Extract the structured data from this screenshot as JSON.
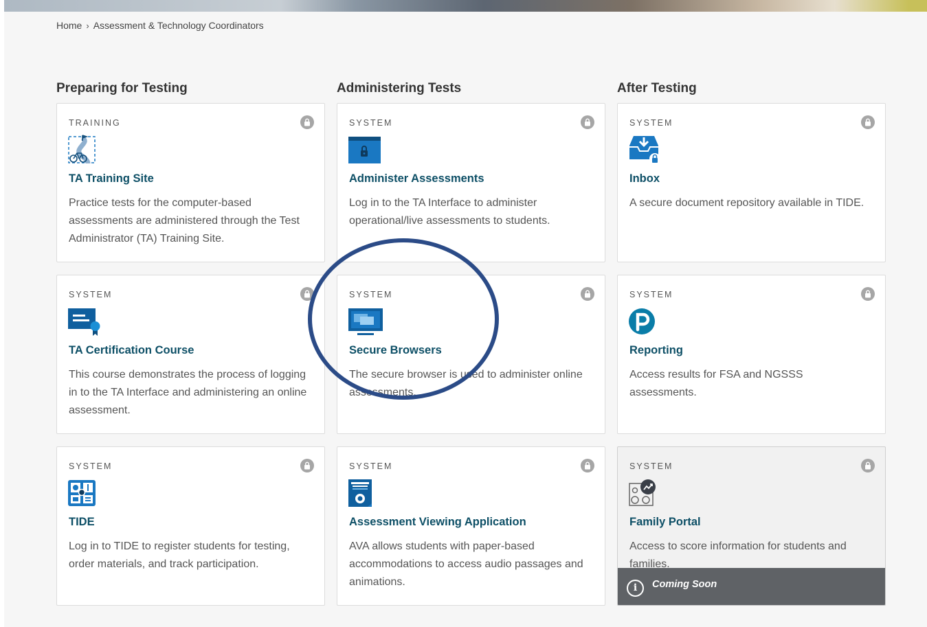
{
  "breadcrumb": {
    "home": "Home",
    "separator": "›",
    "current": "Assessment & Technology Coordinators"
  },
  "columns": [
    {
      "heading": "Preparing for Testing"
    },
    {
      "heading": "Administering Tests"
    },
    {
      "heading": "After Testing"
    }
  ],
  "cards": [
    {
      "kind": "TRAINING",
      "icon": "bicycle-path-icon",
      "title": "TA Training Site",
      "description": "Practice tests for the computer-based assessments are administered through the Test Administrator (TA) Training Site."
    },
    {
      "kind": "SYSTEM",
      "icon": "secure-window-icon",
      "title": "Administer Assessments",
      "description": "Log in to the TA Interface to administer operational/live assessments to students."
    },
    {
      "kind": "SYSTEM",
      "icon": "inbox-download-icon",
      "title": "Inbox",
      "description": "A secure document repository available in TIDE."
    },
    {
      "kind": "SYSTEM",
      "icon": "certificate-icon",
      "title": "TA Certification Course",
      "description": "This course demonstrates the process of logging in to the TA Interface and administering an online assessment."
    },
    {
      "kind": "SYSTEM",
      "icon": "monitor-windows-icon",
      "title": "Secure Browsers",
      "description": "The secure browser is used to administer online assessments."
    },
    {
      "kind": "SYSTEM",
      "icon": "pearson-logo-icon",
      "title": "Reporting",
      "description": "Access results for FSA and NGSSS assessments."
    },
    {
      "kind": "SYSTEM",
      "icon": "tide-grid-icon",
      "title": "TIDE",
      "description": "Log in to TIDE to register students for testing, order materials, and track participation."
    },
    {
      "kind": "SYSTEM",
      "icon": "viewer-device-icon",
      "title": "Assessment Viewing Application",
      "description": "AVA allows students with paper-based accommodations to access audio passages and animations."
    },
    {
      "kind": "SYSTEM",
      "icon": "family-chart-icon",
      "title": "Family Portal",
      "description": "Access to score information for students and families."
    }
  ],
  "coming_soon": {
    "icon": "info-icon",
    "label": "Coming Soon"
  },
  "colors": {
    "title": "#0d4f66",
    "icon_blue": "#1a78c2",
    "annotation": "#2b4b87",
    "overlay": "#5f6266"
  }
}
